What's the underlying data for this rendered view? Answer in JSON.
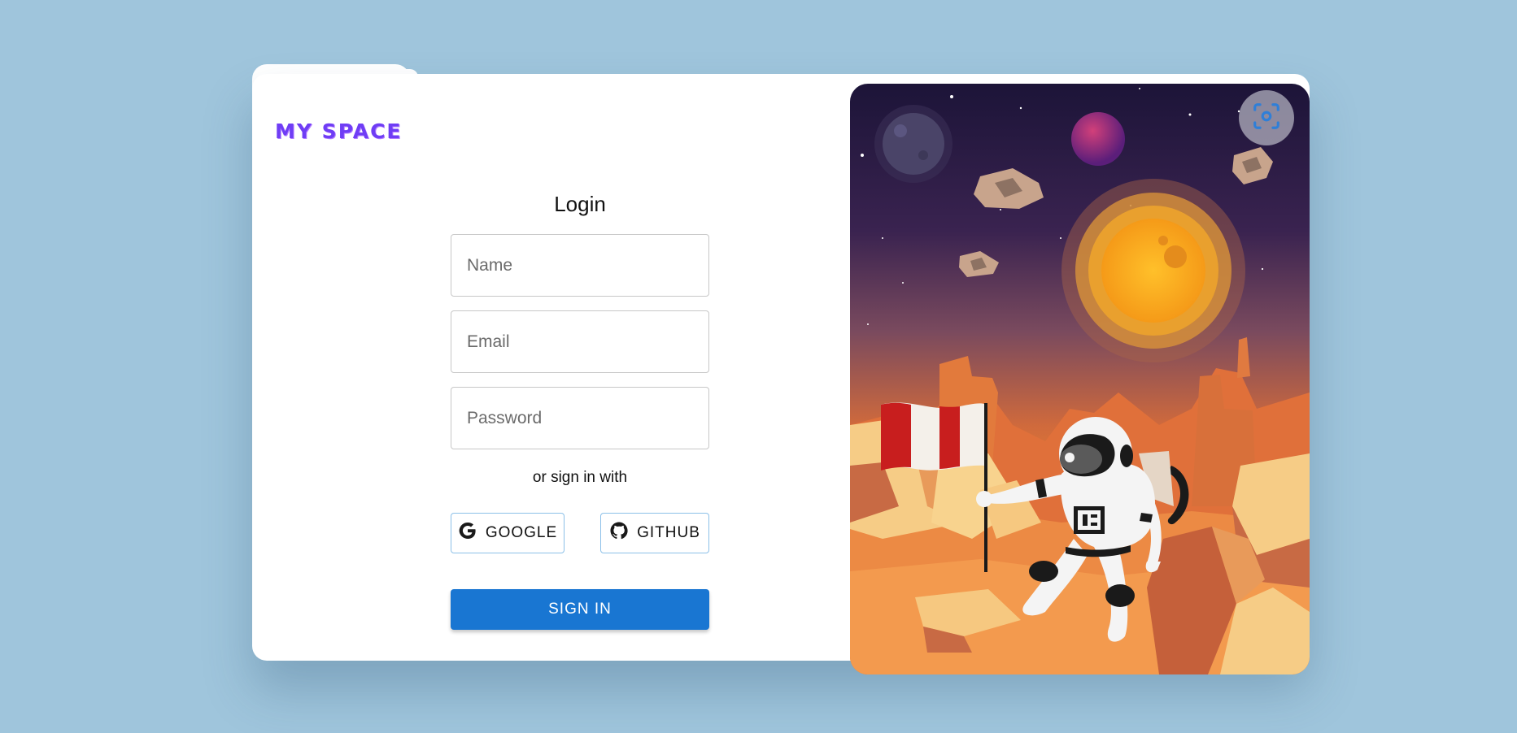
{
  "app": {
    "logo_text": "MY SPACE"
  },
  "login": {
    "title": "Login",
    "name_placeholder": "Name",
    "email_placeholder": "Email",
    "password_placeholder": "Password",
    "alt_text": "or sign in with",
    "google_label": "GOOGLE",
    "github_label": "GITHUB",
    "signin_label": "SIGN IN"
  },
  "illustration": {
    "icon": "astronaut-flag-illustration"
  },
  "capture_button": {
    "icon": "screenshot-capture-icon"
  },
  "colors": {
    "page_background": "#9fc5dc",
    "brand": "#6f3df5",
    "primary": "#1976d2"
  }
}
